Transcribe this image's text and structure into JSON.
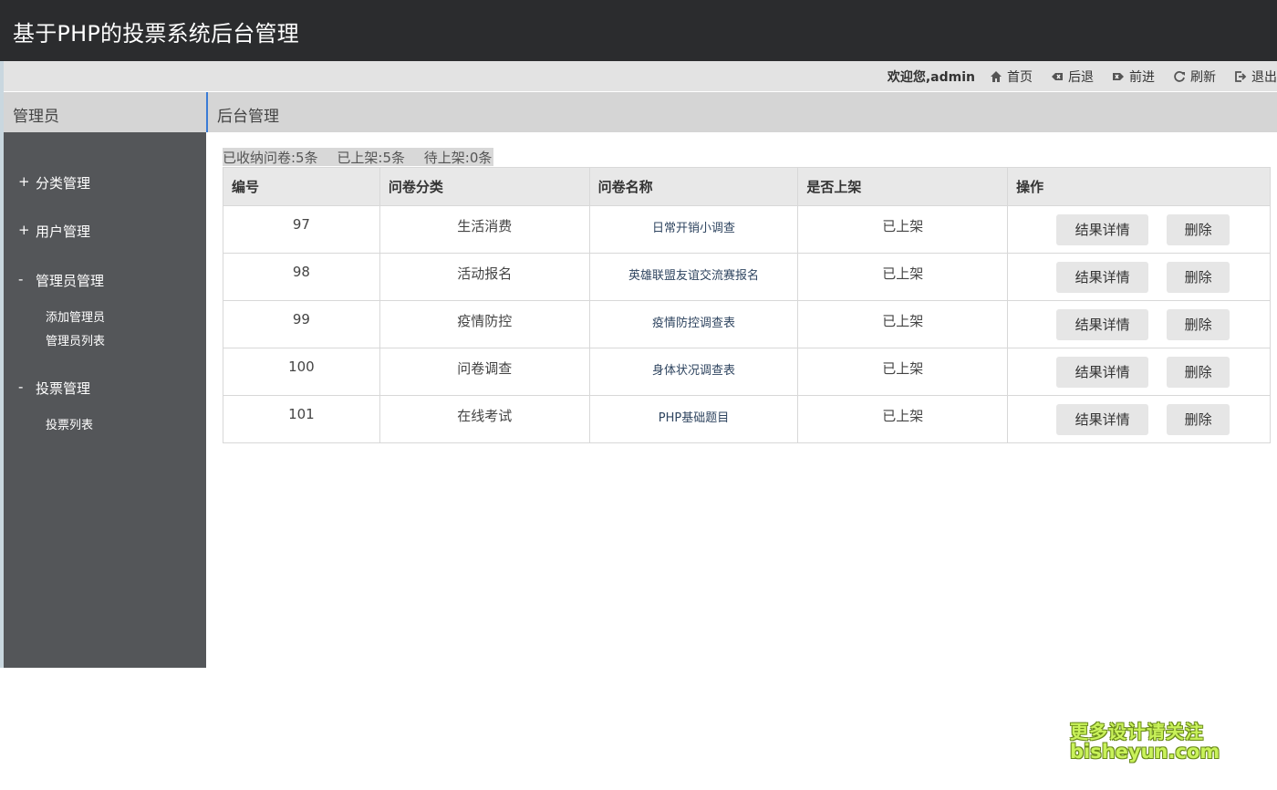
{
  "header": {
    "title": "基于PHP的投票系统后台管理"
  },
  "topnav": {
    "welcome": "欢迎您,admin",
    "links": [
      {
        "label": "首页",
        "icon": "home-icon"
      },
      {
        "label": "后退",
        "icon": "back-icon"
      },
      {
        "label": "前进",
        "icon": "forward-icon"
      },
      {
        "label": "刷新",
        "icon": "refresh-icon"
      },
      {
        "label": "退出",
        "icon": "logout-icon"
      }
    ]
  },
  "sidebar": {
    "heading": "管理员",
    "groups": [
      {
        "sign": "+",
        "label": "分类管理",
        "children": []
      },
      {
        "sign": "+",
        "label": "用户管理",
        "children": []
      },
      {
        "sign": "-",
        "label": "管理员管理",
        "children": [
          "添加管理员",
          "管理员列表"
        ]
      },
      {
        "sign": "-",
        "label": "投票管理",
        "children": [
          "投票列表"
        ]
      }
    ]
  },
  "main": {
    "heading": "后台管理",
    "stats": [
      "已收纳问卷:5条",
      "已上架:5条",
      "待上架:0条"
    ],
    "table": {
      "columns": [
        "编号",
        "问卷分类",
        "问卷名称",
        "是否上架",
        "操作"
      ],
      "rows": [
        {
          "id": "97",
          "category": "生活消费",
          "name": "日常开销小调查",
          "status": "已上架"
        },
        {
          "id": "98",
          "category": "活动报名",
          "name": "英雄联盟友谊交流赛报名",
          "status": "已上架"
        },
        {
          "id": "99",
          "category": "疫情防控",
          "name": "疫情防控调查表",
          "status": "已上架"
        },
        {
          "id": "100",
          "category": "问卷调查",
          "name": "身体状况调查表",
          "status": "已上架"
        },
        {
          "id": "101",
          "category": "在线考试",
          "name": "PHP基础题目",
          "status": "已上架"
        }
      ],
      "detail_label": "结果详情",
      "delete_label": "删除"
    }
  },
  "watermark": {
    "line1": "更多设计请关注",
    "line2": "bisheyun.com"
  }
}
